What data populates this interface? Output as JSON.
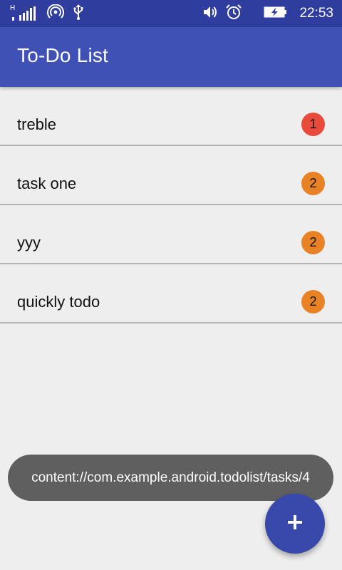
{
  "status_bar": {
    "network_label": "H",
    "time": "22:53",
    "icons": [
      "signal-icon",
      "hotspot-icon",
      "usb-icon",
      "volume-icon",
      "alarm-icon",
      "battery-charging-icon"
    ]
  },
  "app_bar": {
    "title": "To-Do List",
    "background": "#3f51b5"
  },
  "tasks": [
    {
      "label": "treble",
      "priority": "1",
      "badge_color": "#e84a3c"
    },
    {
      "label": "task one",
      "priority": "2",
      "badge_color": "#e98225"
    },
    {
      "label": "yyy",
      "priority": "2",
      "badge_color": "#e98225"
    },
    {
      "label": "quickly todo",
      "priority": "2",
      "badge_color": "#e98225"
    }
  ],
  "toast": {
    "message": "content://com.example.android.todolist/tasks/4"
  },
  "fab": {
    "icon": "plus-icon",
    "color": "#3949ab"
  }
}
